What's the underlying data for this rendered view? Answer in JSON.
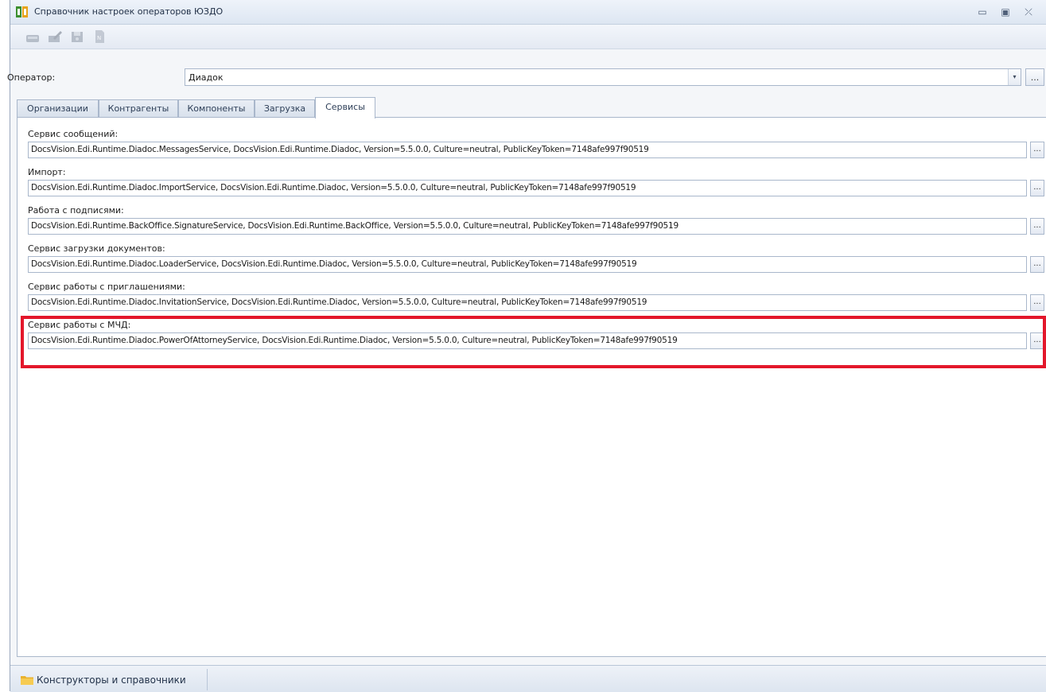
{
  "window": {
    "title": "Справочник настроек операторов ЮЗДО",
    "minimize_glyph": "▭",
    "maximize_glyph": "▣",
    "close_glyph": "⤫"
  },
  "toolbar": {
    "buttons": [
      "open-icon",
      "edit-icon",
      "save-icon",
      "document-icon"
    ]
  },
  "operator": {
    "label": "Оператор:",
    "value": "Диадок",
    "dropdown_glyph": "▾",
    "more_label": "..."
  },
  "tabs": [
    {
      "label": "Организации",
      "active": false
    },
    {
      "label": "Контрагенты",
      "active": false
    },
    {
      "label": "Компоненты",
      "active": false
    },
    {
      "label": "Загрузка",
      "active": false
    },
    {
      "label": "Сервисы",
      "active": true
    }
  ],
  "services": [
    {
      "label": "Сервис сообщений:",
      "value": "DocsVision.Edi.Runtime.Diadoc.MessagesService, DocsVision.Edi.Runtime.Diadoc, Version=5.5.0.0, Culture=neutral, PublicKeyToken=7148afe997f90519",
      "button": "..."
    },
    {
      "label": "Импорт:",
      "value": "DocsVision.Edi.Runtime.Diadoc.ImportService, DocsVision.Edi.Runtime.Diadoc, Version=5.5.0.0, Culture=neutral, PublicKeyToken=7148afe997f90519",
      "button": "..."
    },
    {
      "label": "Работа с подписями:",
      "value": "DocsVision.Edi.Runtime.BackOffice.SignatureService, DocsVision.Edi.Runtime.BackOffice, Version=5.5.0.0, Culture=neutral, PublicKeyToken=7148afe997f90519",
      "button": "..."
    },
    {
      "label": "Сервис загрузки документов:",
      "value": "DocsVision.Edi.Runtime.Diadoc.LoaderService, DocsVision.Edi.Runtime.Diadoc, Version=5.5.0.0, Culture=neutral, PublicKeyToken=7148afe997f90519",
      "button": "..."
    },
    {
      "label": "Сервис работы с приглашениями:",
      "value": "DocsVision.Edi.Runtime.Diadoc.InvitationService, DocsVision.Edi.Runtime.Diadoc, Version=5.5.0.0, Culture=neutral, PublicKeyToken=7148afe997f90519",
      "button": "..."
    },
    {
      "label": "Сервис работы с МЧД:",
      "value": "DocsVision.Edi.Runtime.Diadoc.PowerOfAttorneyService, DocsVision.Edi.Runtime.Diadoc, Version=5.5.0.0, Culture=neutral, PublicKeyToken=7148afe997f90519",
      "button": "..."
    }
  ],
  "highlight_color": "#e3172b",
  "statusbar": {
    "button_label": "Конструкторы и справочники",
    "icon": "folder-icon"
  }
}
